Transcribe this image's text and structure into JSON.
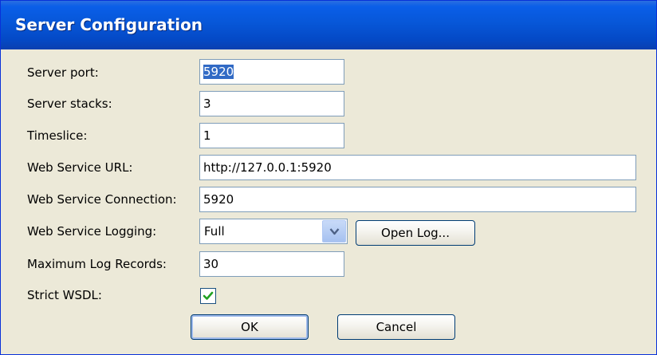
{
  "window": {
    "title": "Server Configuration"
  },
  "fields": {
    "server_port": {
      "label": "Server port:",
      "value": "5920"
    },
    "server_stacks": {
      "label": "Server stacks:",
      "value": "3"
    },
    "timeslice": {
      "label": "Timeslice:",
      "value": "1"
    },
    "web_service_url": {
      "label": "Web Service URL:",
      "value": "http://127.0.0.1:5920"
    },
    "web_service_connection": {
      "label": "Web Service Connection:",
      "value": "5920"
    },
    "web_service_logging": {
      "label": "Web Service Logging:",
      "value": "Full",
      "icon": "chevron-down-icon"
    },
    "maximum_log_records": {
      "label": "Maximum Log Records:",
      "value": "30"
    },
    "strict_wsdl": {
      "label": "Strict WSDL:",
      "checked": true,
      "icon": "checkmark-icon"
    }
  },
  "buttons": {
    "open_log": "Open Log...",
    "ok": "OK",
    "cancel": "Cancel"
  },
  "colors": {
    "titlebar": "#0757d8",
    "dialog_background": "#ece9d8",
    "selection": "#316ac5",
    "check": "#21a121"
  }
}
